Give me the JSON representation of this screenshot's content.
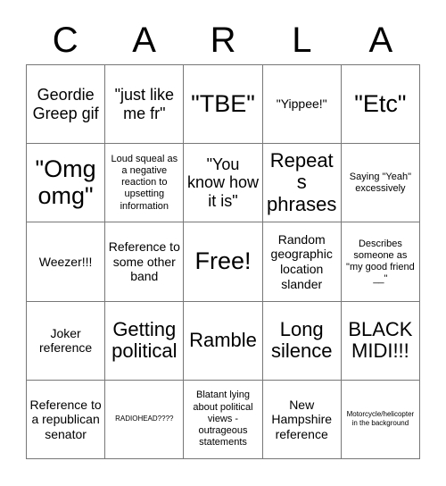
{
  "card": {
    "header_letters": [
      "C",
      "A",
      "R",
      "L",
      "A"
    ],
    "columns": 5,
    "rows": 5,
    "background_color": "#ffffff",
    "text_color": "#000000",
    "border_color": "#777777",
    "cells": [
      {
        "text": "Geordie Greep gif",
        "size": "fs-lg"
      },
      {
        "text": "\"just like me fr\"",
        "size": "fs-lg"
      },
      {
        "text": "\"TBE\"",
        "size": "fs-xxl"
      },
      {
        "text": "\"Yippee!\"",
        "size": "fs-md"
      },
      {
        "text": "\"Etc\"",
        "size": "fs-xxl"
      },
      {
        "text": "\"Omg omg\"",
        "size": "fs-xxl"
      },
      {
        "text": "Loud squeal as a negative reaction to upsetting information",
        "size": "fs-sm"
      },
      {
        "text": "\"You know how it is\"",
        "size": "fs-lg"
      },
      {
        "text": "Repeats phrases",
        "size": "fs-xl"
      },
      {
        "text": "Saying \"Yeah\" excessively",
        "size": "fs-sm"
      },
      {
        "text": "Weezer!!!",
        "size": "fs-md"
      },
      {
        "text": "Reference to some other band",
        "size": "fs-md"
      },
      {
        "text": "Free!",
        "size": "fs-xxl"
      },
      {
        "text": "Random geographic location slander",
        "size": "fs-md"
      },
      {
        "text": "Describes someone as \"my good friend __\"",
        "size": "fs-sm"
      },
      {
        "text": "Joker reference",
        "size": "fs-md"
      },
      {
        "text": "Getting political",
        "size": "fs-xl"
      },
      {
        "text": "Ramble",
        "size": "fs-xl"
      },
      {
        "text": "Long silence",
        "size": "fs-xl"
      },
      {
        "text": "BLACK MIDI!!!",
        "size": "fs-xl"
      },
      {
        "text": "Reference to a republican senator",
        "size": "fs-md"
      },
      {
        "text": "RADIOHEAD????",
        "size": "fs-xs"
      },
      {
        "text": "Blatant lying about political views - outrageous statements",
        "size": "fs-sm"
      },
      {
        "text": "New Hampshire reference",
        "size": "fs-md"
      },
      {
        "text": "Motorcycle/helicopter in the background",
        "size": "fs-xs"
      }
    ]
  }
}
